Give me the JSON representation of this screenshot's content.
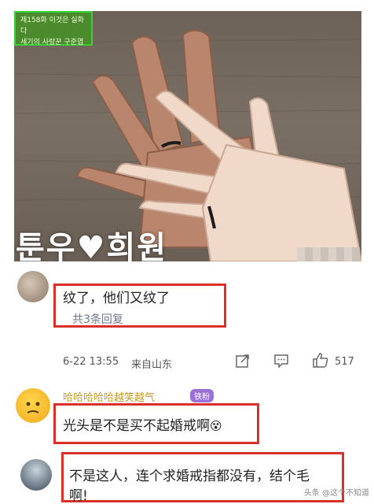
{
  "photo": {
    "tv_tag_line1": "제158화 이것은 실화다",
    "tv_tag_line2": "세기의 사랑꾼 구준엽",
    "names_caption": "툰우♥희원"
  },
  "comment1": {
    "text": "纹了，他们又纹了",
    "replies_label": "共3条回复",
    "timestamp": "6-22 13:55",
    "location": "来自山东",
    "like_count": "517"
  },
  "comment2": {
    "username": "哈哈哈哈哈越笑越气",
    "badge": "铁粉",
    "text": "光头是不是买不起婚戒啊",
    "emoji": "😵"
  },
  "comment3": {
    "text_line1": "不是这人，连个求婚戒指都没有，结个毛",
    "text_line2": "啊!"
  },
  "watermark": "头条 @这个不知道",
  "colors": {
    "annotation_red": "#d9302a",
    "link_blue": "#4a6fa5"
  }
}
